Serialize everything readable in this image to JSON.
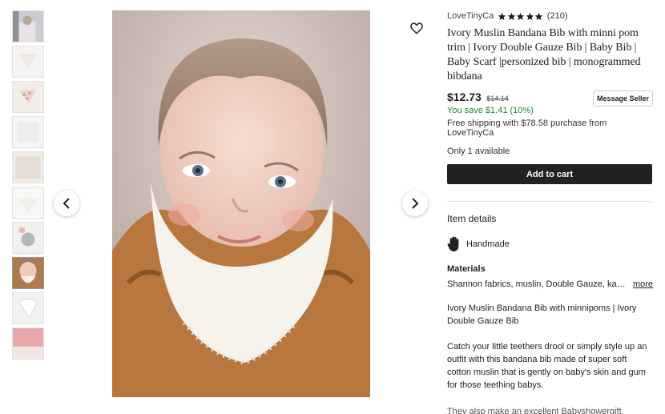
{
  "shop": {
    "name": "LoveTinyCa",
    "rating_stars": 5,
    "reviews": "(210)"
  },
  "product": {
    "title": "Ivory Muslin Bandana Bib with minni pom trim | Ivory Double Gauze Bib | Baby Bib | Baby Scarf |personized bib | monogrammed bibdana",
    "price": "$12.73",
    "old_price": "$14.14",
    "savings": "You save $1.41 (10%)",
    "shipping": "Free shipping with $78.58 purchase from LoveTinyCa",
    "availability": "Only 1 available"
  },
  "buttons": {
    "message_seller": "Message Seller",
    "add_to_cart": "Add to cart"
  },
  "details": {
    "section_title": "Item details",
    "handmade": "Handmade",
    "materials_label": "Materials",
    "materials": "Shannon fabrics, muslin, Double Gauze, kam snaps",
    "more": "more",
    "description_1": "Ivory Muslin Bandana Bib with minnipoms | Ivory Double Gauze Bib",
    "description_2": "Catch your little teethers drool or simply style up an outfit with this bandana bib made of super soft cotton muslin that is gently on baby's skin and gum for those teething babys.",
    "description_3": "They also make an excellent Babyshowergift."
  },
  "gallery": {
    "selected_index": 7,
    "thumbnail_count": 10
  },
  "icons": {
    "favorite": "heart-icon",
    "prev": "chevron-left-icon",
    "next": "chevron-right-icon",
    "star": "star-icon",
    "handmade": "hand-icon"
  },
  "colors": {
    "cart_button": "#222222",
    "savings_green": "#258635"
  }
}
